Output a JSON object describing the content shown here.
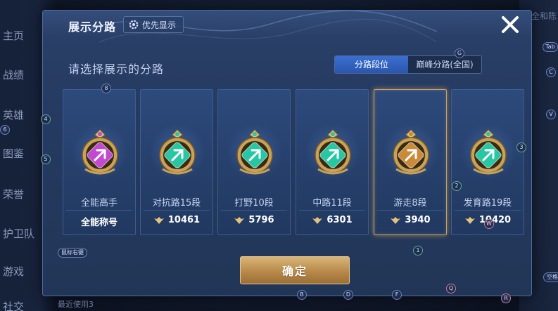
{
  "background_nav": {
    "items": [
      "主页",
      "战绩",
      "英雄",
      "图鉴",
      "荣誉",
      "护卫队",
      "游戏",
      "社交"
    ],
    "right_text": "全和陈",
    "bottom_text": "最近使用3"
  },
  "dialog": {
    "title": "展示分路",
    "priority_button": "优先显示",
    "subtitle": "请选择展示的分路",
    "tabs": [
      {
        "label": "分路段位",
        "active": true
      },
      {
        "label": "巅峰分路(全国)",
        "active": false
      }
    ],
    "confirm_label": "确定"
  },
  "cards": [
    {
      "name": "全能高手",
      "value": "全能称号",
      "emblem": "all-round-emblem-icon",
      "color": "#c04ad0",
      "show_rank_icon": false,
      "selected": false
    },
    {
      "name": "对抗路15段",
      "value": "10461",
      "emblem": "clash-lane-emblem-icon",
      "color": "#27c7a4",
      "show_rank_icon": true,
      "selected": false
    },
    {
      "name": "打野10段",
      "value": "5796",
      "emblem": "jungle-emblem-icon",
      "color": "#27c7a4",
      "show_rank_icon": true,
      "selected": false
    },
    {
      "name": "中路11段",
      "value": "6301",
      "emblem": "mid-lane-emblem-icon",
      "color": "#27c7a4",
      "show_rank_icon": true,
      "selected": false
    },
    {
      "name": "游走8段",
      "value": "3940",
      "emblem": "roam-emblem-icon",
      "color": "#c98a3a",
      "show_rank_icon": true,
      "selected": true
    },
    {
      "name": "发育路19段",
      "value": "10420",
      "emblem": "farm-lane-emblem-icon",
      "color": "#27c7a4",
      "show_rank_icon": true,
      "selected": false
    }
  ],
  "key_markers": [
    "8",
    "4",
    "6",
    "5",
    "G",
    "Tab",
    "C",
    "V",
    "3",
    "2",
    "1",
    "W",
    "B",
    "D",
    "F",
    "Q",
    "R"
  ],
  "key_pills": [
    "鼠标右键",
    "空格"
  ],
  "colors": {
    "accent_blue": "#3a6fd0",
    "confirm_gold": "#c9a064",
    "dialog_bg": "#263c63"
  }
}
